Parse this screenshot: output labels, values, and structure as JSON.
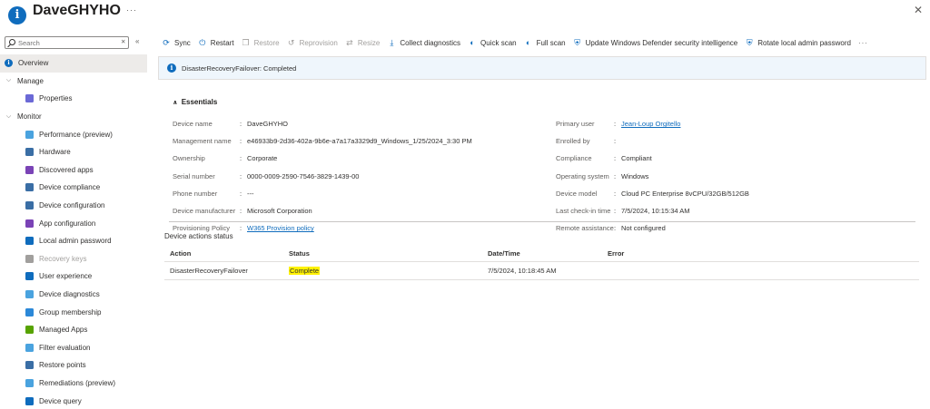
{
  "header": {
    "title": "DaveGHYHO",
    "more": "···",
    "close": "✕"
  },
  "sidebar": {
    "search_placeholder": "Search",
    "search_clear": "✕",
    "collapse": "«",
    "items": [
      {
        "label": "Overview",
        "level": "top",
        "icon": "info-icon",
        "color": "#0f6cbd",
        "active": true
      },
      {
        "label": "Manage",
        "level": "section",
        "icon": "chevron-down-icon"
      },
      {
        "label": "Properties",
        "level": "sub",
        "icon": "properties-icon",
        "color": "#6b69d6"
      },
      {
        "label": "Monitor",
        "level": "section",
        "icon": "chevron-down-icon"
      },
      {
        "label": "Performance (preview)",
        "level": "sub",
        "icon": "performance-icon",
        "color": "#4aa3df"
      },
      {
        "label": "Hardware",
        "level": "sub",
        "icon": "hardware-icon",
        "color": "#3a6ea5"
      },
      {
        "label": "Discovered apps",
        "level": "sub",
        "icon": "discovered-apps-icon",
        "color": "#7a43b6"
      },
      {
        "label": "Device compliance",
        "level": "sub",
        "icon": "device-compliance-icon",
        "color": "#3a6ea5"
      },
      {
        "label": "Device configuration",
        "level": "sub",
        "icon": "device-configuration-icon",
        "color": "#3a6ea5"
      },
      {
        "label": "App configuration",
        "level": "sub",
        "icon": "app-configuration-icon",
        "color": "#7a43b6"
      },
      {
        "label": "Local admin password",
        "level": "sub",
        "icon": "local-admin-password-icon",
        "color": "#0f6cbd"
      },
      {
        "label": "Recovery keys",
        "level": "sub",
        "icon": "recovery-keys-icon",
        "color": "#a19f9d",
        "disabled": true
      },
      {
        "label": "User experience",
        "level": "sub",
        "icon": "user-experience-icon",
        "color": "#0f6cbd"
      },
      {
        "label": "Device diagnostics",
        "level": "sub",
        "icon": "device-diagnostics-icon",
        "color": "#4aa3df"
      },
      {
        "label": "Group membership",
        "level": "sub",
        "icon": "group-membership-icon",
        "color": "#2b88d8"
      },
      {
        "label": "Managed Apps",
        "level": "sub",
        "icon": "managed-apps-icon",
        "color": "#57a300"
      },
      {
        "label": "Filter evaluation",
        "level": "sub",
        "icon": "filter-evaluation-icon",
        "color": "#4aa3df"
      },
      {
        "label": "Restore points",
        "level": "sub",
        "icon": "restore-points-icon",
        "color": "#3a6ea5"
      },
      {
        "label": "Remediations (preview)",
        "level": "sub",
        "icon": "remediations-icon",
        "color": "#4aa3df"
      },
      {
        "label": "Device query",
        "level": "sub",
        "icon": "device-query-icon",
        "color": "#0f6cbd"
      }
    ]
  },
  "toolbar": {
    "items": [
      {
        "label": "Sync",
        "glyph": "⟳",
        "icon": "sync-icon"
      },
      {
        "label": "Restart",
        "glyph": "⏻",
        "icon": "restart-icon"
      },
      {
        "label": "Restore",
        "glyph": "❐",
        "icon": "restore-icon",
        "disabled": true
      },
      {
        "label": "Reprovision",
        "glyph": "↺",
        "icon": "reprovision-icon",
        "disabled": true
      },
      {
        "label": "Resize",
        "glyph": "⇄",
        "icon": "resize-icon",
        "disabled": true
      },
      {
        "label": "Collect diagnostics",
        "glyph": "⤓",
        "icon": "download-icon"
      },
      {
        "label": "Quick scan",
        "glyph": "◐",
        "icon": "quick-scan-icon"
      },
      {
        "label": "Full scan",
        "glyph": "◐",
        "icon": "full-scan-icon"
      },
      {
        "label": "Update Windows Defender security intelligence",
        "glyph": "⛨",
        "icon": "defender-update-icon"
      },
      {
        "label": "Rotate local admin password",
        "glyph": "⛨",
        "icon": "rotate-password-icon"
      }
    ],
    "more": "···"
  },
  "banner": {
    "text": "DisasterRecoveryFailover: Completed"
  },
  "essentials": {
    "title": "Essentials",
    "left": [
      {
        "label": "Device name",
        "value": "DaveGHYHO"
      },
      {
        "label": "Management name",
        "value": "e46933b9-2d36-402a-9b6e-a7a17a3329d9_Windows_1/25/2024_3:30 PM"
      },
      {
        "label": "Ownership",
        "value": "Corporate"
      },
      {
        "label": "Serial number",
        "value": "0000-0009-2590-7546-3829-1439-00"
      },
      {
        "label": "Phone number",
        "value": "---"
      },
      {
        "label": "Device manufacturer",
        "value": "Microsoft Corporation"
      },
      {
        "label": "Provisioning Policy",
        "value": "W365 Provision policy",
        "link": true
      }
    ],
    "right": [
      {
        "label": "Primary user",
        "value": "Jean-Loup Orgitello",
        "link": true
      },
      {
        "label": "Enrolled by",
        "value": ""
      },
      {
        "label": "Compliance",
        "value": "Compliant"
      },
      {
        "label": "Operating system",
        "value": "Windows"
      },
      {
        "label": "Device model",
        "value": "Cloud PC Enterprise 8vCPU/32GB/512GB"
      },
      {
        "label": "Last check-in time",
        "value": "7/5/2024, 10:15:34 AM"
      },
      {
        "label": "Remote assistance",
        "value": "Not configured"
      }
    ]
  },
  "device_actions": {
    "title": "Device actions status",
    "columns": [
      "Action",
      "Status",
      "Date/Time",
      "Error"
    ],
    "rows": [
      {
        "action": "DisasterRecoveryFailover",
        "status": "Complete",
        "datetime": "7/5/2024, 10:18:45 AM",
        "error": ""
      }
    ],
    "highlight_color": "#fff200"
  }
}
